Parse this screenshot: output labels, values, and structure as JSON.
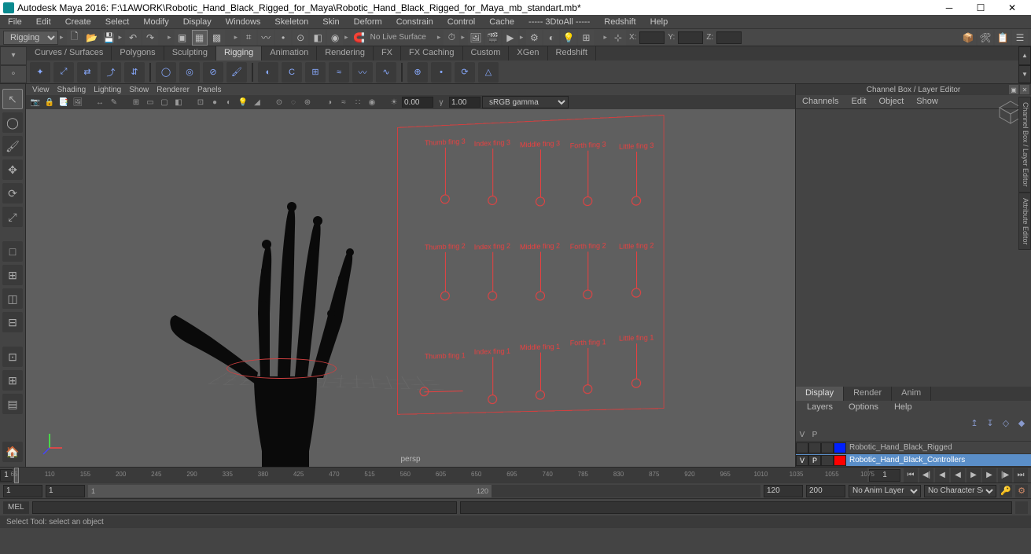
{
  "titlebar": {
    "title": "Autodesk Maya 2016: F:\\1AWORK\\Robotic_Hand_Black_Rigged_for_Maya\\Robotic_Hand_Black_Rigged_for_Maya_mb_standart.mb*"
  },
  "menubar": {
    "items": [
      "File",
      "Edit",
      "Create",
      "Select",
      "Modify",
      "Display",
      "Windows",
      "Skeleton",
      "Skin",
      "Deform",
      "Constrain",
      "Control",
      "Cache",
      "----- 3DtoAll -----",
      "Redshift",
      "Help"
    ]
  },
  "statusline": {
    "workspace": "Rigging",
    "live_surface": "No Live Surface",
    "coord_x_label": "X:",
    "coord_y_label": "Y:",
    "coord_z_label": "Z:"
  },
  "shelf": {
    "tabs": [
      "Curves / Surfaces",
      "Polygons",
      "Sculpting",
      "Rigging",
      "Animation",
      "Rendering",
      "FX",
      "FX Caching",
      "Custom",
      "XGen",
      "Redshift"
    ],
    "active_tab": "Rigging"
  },
  "viewport": {
    "menu": [
      "View",
      "Shading",
      "Lighting",
      "Show",
      "Renderer",
      "Panels"
    ],
    "exposure": "0.00",
    "gamma": "1.00",
    "colorspace": "sRGB gamma",
    "camera": "persp",
    "controls": {
      "row1": [
        "Thumb fing 3",
        "Index fing 3",
        "Middle fing 3",
        "Forth fing 3",
        "Little fing 3"
      ],
      "row2": [
        "Thumb fing 2",
        "Index fing 2",
        "Middle fing 2",
        "Forth fing 2",
        "Little fing 2"
      ],
      "row3": [
        "Thumb fing 1",
        "Index fing 1",
        "Middle fing 1",
        "Forth fing 1",
        "Little fing 1"
      ]
    }
  },
  "channelbox": {
    "title": "Channel Box / Layer Editor",
    "menu": [
      "Channels",
      "Edit",
      "Object",
      "Show"
    ],
    "tabs": [
      "Display",
      "Render",
      "Anim"
    ],
    "active_tab": "Display",
    "layer_menu": [
      "Layers",
      "Options",
      "Help"
    ],
    "layer_header": {
      "v": "V",
      "p": "P"
    },
    "layers": [
      {
        "vis": "",
        "play": "",
        "color": "#0020ff",
        "name": "Robotic_Hand_Black_Rigged",
        "selected": false
      },
      {
        "vis": "V",
        "play": "P",
        "color": "#ff0000",
        "name": "Robotic_Hand_Black_Controllers",
        "selected": true
      }
    ]
  },
  "side_tabs": [
    "Channel Box / Layer Editor",
    "Attribute Editor"
  ],
  "timeslider": {
    "start": "1",
    "current": "1",
    "ticks": [
      "65",
      "110",
      "155",
      "200",
      "245",
      "290",
      "335",
      "380",
      "425",
      "470",
      "515",
      "560",
      "605",
      "650",
      "695",
      "740",
      "785",
      "830",
      "875",
      "920",
      "965",
      "1010",
      "1035",
      "1055",
      "1075"
    ]
  },
  "rangeslider": {
    "anim_start": "1",
    "play_start": "1",
    "bar_start": "1",
    "bar_end": "120",
    "play_end": "120",
    "anim_end": "200",
    "anim_layer": "No Anim Layer",
    "char_set": "No Character Set"
  },
  "cmdline": {
    "label": "MEL"
  },
  "helpline": {
    "text": "Select Tool: select an object"
  }
}
